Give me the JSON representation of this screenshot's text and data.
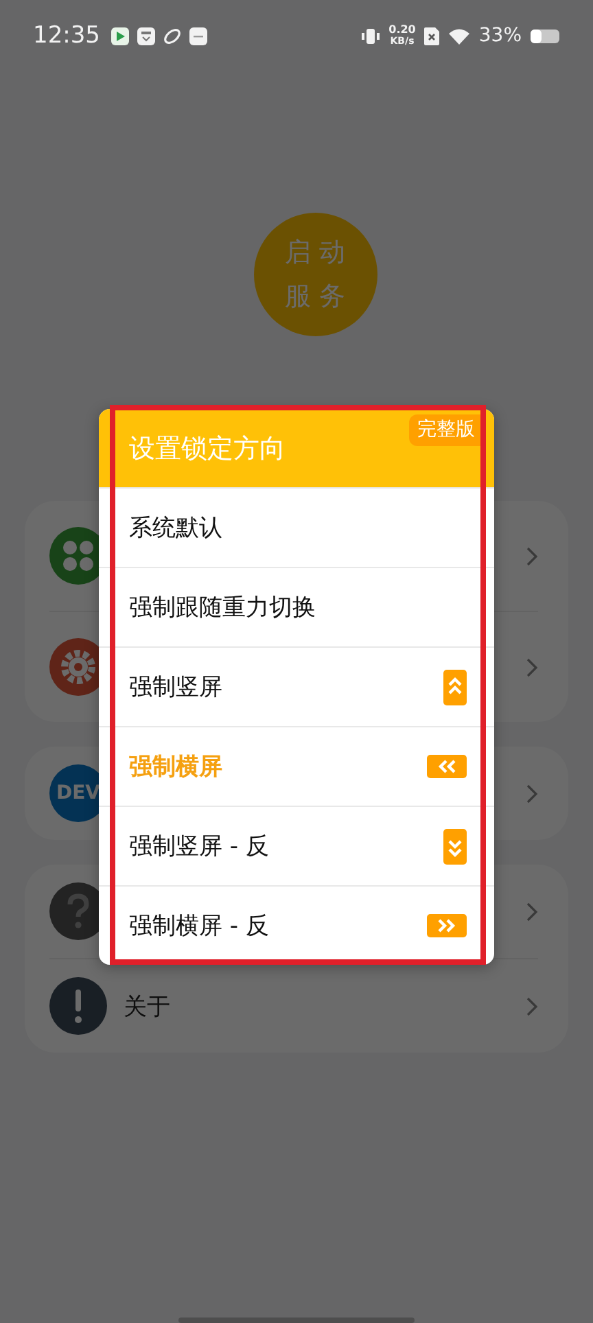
{
  "status_bar": {
    "time": "12:35",
    "net_speed_value": "0.20",
    "net_speed_unit": "KB/s",
    "battery": "33%"
  },
  "start_button": {
    "lines": [
      "启动",
      "服务"
    ]
  },
  "menu_groups": [
    {
      "items": [
        {
          "kind": "apps"
        },
        {
          "kind": "gear"
        }
      ]
    },
    {
      "items": [
        {
          "kind": "dev",
          "icon_text": "DEV"
        }
      ]
    },
    {
      "items": [
        {
          "kind": "help"
        },
        {
          "kind": "info",
          "label": "关于"
        }
      ]
    }
  ],
  "dialog": {
    "title": "设置锁定方向",
    "badge": "完整版",
    "highlighted": true,
    "options": [
      {
        "kind": "plain",
        "label": "系统默认",
        "selected": false
      },
      {
        "kind": "plain",
        "label": "强制跟随重力切换",
        "selected": false
      },
      {
        "kind": "up",
        "label": "强制竖屏",
        "selected": false
      },
      {
        "kind": "left",
        "label": "强制横屏",
        "selected": true
      },
      {
        "kind": "down",
        "label": "强制竖屏 - 反",
        "selected": false
      },
      {
        "kind": "right",
        "label": "强制横屏 - 反",
        "selected": false
      }
    ]
  }
}
